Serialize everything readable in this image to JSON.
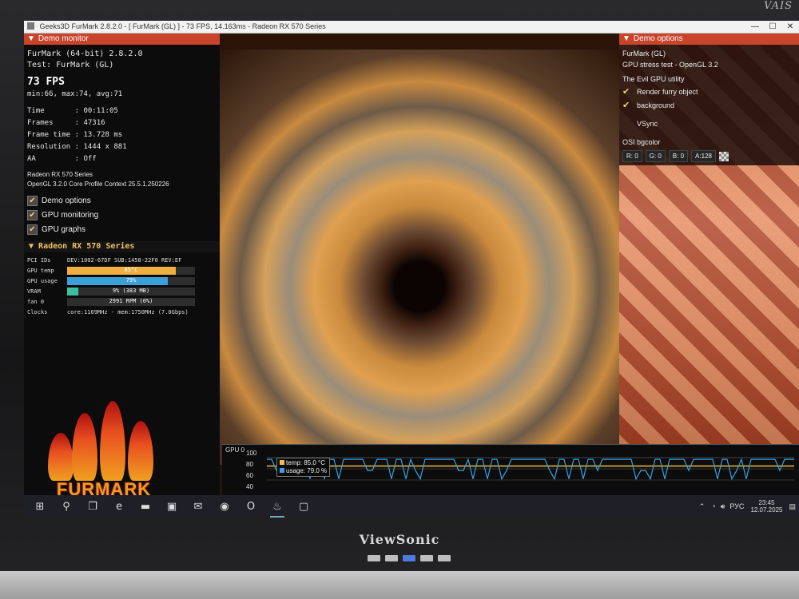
{
  "bezel": {
    "top_brand": "VAIS",
    "bottom_brand": "ViewSonic"
  },
  "window": {
    "title": "Geeks3D FurMark 2.8.2.0 - [ FurMark (GL) ] - 73 FPS, 14.163ms - Radeon RX 570 Series",
    "min": "—",
    "max": "☐",
    "close": "✕"
  },
  "monitor": {
    "header": "Demo monitor",
    "app": "FurMark (64-bit) 2.8.2.0",
    "test": "Test: FurMark (GL)",
    "fps": "73 FPS",
    "minmax": "min:66, max:74, avg:71",
    "stats": [
      "Time       : 00:11:05",
      "Frames     : 47316",
      "Frame time : 13.728 ms",
      "Resolution : 1444 x 881",
      "AA         : Off"
    ],
    "gpu_name": "Radeon RX 570 Series",
    "gl_info": "OpenGL 3.2.0 Core Profile Context 25.5.1.250226",
    "checks": [
      {
        "label": "Demo options"
      },
      {
        "label": "GPU monitoring"
      },
      {
        "label": "GPU graphs"
      }
    ]
  },
  "gpu": {
    "header": "Radeon RX 570 Series",
    "pci_label": "PCI IDs",
    "pci_value": "DEV:1002-67DF SUB:1458-22F0 REV:EF",
    "rows": [
      {
        "label": "GPU temp",
        "text": "85°C",
        "fill": 0.85,
        "color": "#f0b040"
      },
      {
        "label": "GPU usage",
        "text": "79%",
        "fill": 0.79,
        "color": "#3ca0d8"
      },
      {
        "label": "VRAM",
        "text": "9% (383 MB)",
        "fill": 0.09,
        "color": "#3cc0a0"
      },
      {
        "label": "fan 0",
        "text": "2991 RPM (0%)",
        "fill": 0.0,
        "color": "#4a4a4a"
      }
    ],
    "clocks_label": "Clocks",
    "clocks_value": "core:1169MHz - mem:1750MHz (7.0Gbps)"
  },
  "logo": {
    "text": "FURMARK"
  },
  "options": {
    "header": "Demo options",
    "lines": [
      "FurMark (GL)",
      "GPU stress test - OpenGL 3.2",
      "The Evil GPU utility"
    ],
    "checks": [
      {
        "label": "Render furry object",
        "checked": "✔"
      },
      {
        "label": "background",
        "checked": "✔"
      },
      {
        "label": "VSync",
        "checked": ""
      }
    ],
    "bg_label": "OSI bgcolor",
    "color_fields": [
      "R: 0",
      "G: 0",
      "B: 0",
      "A:128"
    ]
  },
  "graph": {
    "label": "GPU 0",
    "axis": [
      "100",
      "80",
      "60",
      "40"
    ],
    "legend_temp": "temp: 85.0 °C",
    "legend_usage": "usage: 79.0 %",
    "temp_color": "#f0c040",
    "usage_color": "#3aa0e0"
  },
  "taskbar": {
    "apps": [
      {
        "icon": "windows-start-icon",
        "glyph": "⊞"
      },
      {
        "icon": "search-icon",
        "glyph": "⚲"
      },
      {
        "icon": "task-view-icon",
        "glyph": "❐"
      },
      {
        "icon": "edge-icon",
        "glyph": "e"
      },
      {
        "icon": "file-explorer-icon",
        "glyph": "▬"
      },
      {
        "icon": "store-icon",
        "glyph": "▣"
      },
      {
        "icon": "mail-icon",
        "glyph": "✉"
      },
      {
        "icon": "chrome-icon",
        "glyph": "◉"
      },
      {
        "icon": "opera-icon",
        "glyph": "O"
      },
      {
        "icon": "furmark-icon",
        "glyph": "♨"
      },
      {
        "icon": "app-window-icon",
        "glyph": "▢"
      }
    ],
    "lang": "РУС",
    "time": "23:45",
    "date": "12.07.2025"
  }
}
